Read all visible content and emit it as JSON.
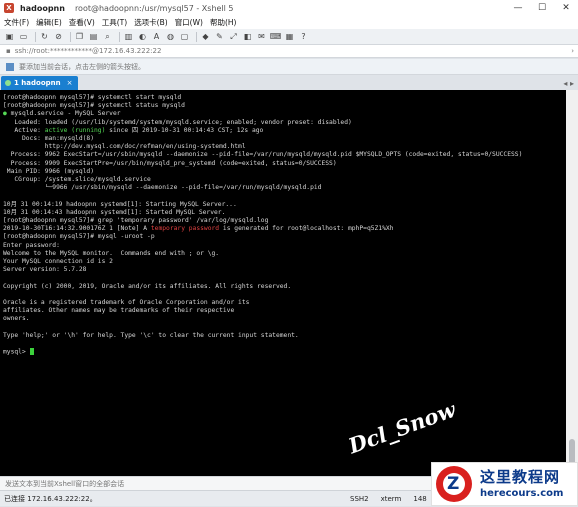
{
  "window": {
    "name": "hadoopnn",
    "subtitle": "root@hadoopnn:/usr/mysql57 - Xshell 5",
    "min_glyph": "—",
    "max_glyph": "☐",
    "close_glyph": "✕"
  },
  "menu": [
    "文件(F)",
    "编辑(E)",
    "查看(V)",
    "工具(T)",
    "选项卡(B)",
    "窗口(W)",
    "帮助(H)"
  ],
  "address": {
    "value": "ssh://root:************@172.16.43.222:22"
  },
  "hint": {
    "text": "要添加当前会话，点击左侧的箭头按钮。"
  },
  "tab": {
    "label": "1 hadoopnn"
  },
  "terminal": {
    "lines": [
      {
        "t": "[root@hadoopnn mysql57]# systemctl start mysqld"
      },
      {
        "t": "[root@hadoopnn mysql57]# systemctl status mysqld"
      },
      {
        "pre": "● ",
        "pre_color": "g",
        "t": "mysqld.service - MySQL Server"
      },
      {
        "t": "   Loaded: loaded (/usr/lib/systemd/system/mysqld.service; enabled; vendor preset: disabled)"
      },
      {
        "t": "   Active: ",
        "hl": "active (running)",
        "hl_color": "g",
        "post": " since 四 2019-10-31 00:14:43 CST; 12s ago"
      },
      {
        "t": "     Docs: man:mysqld(8)"
      },
      {
        "t": "           http://dev.mysql.com/doc/refman/en/using-systemd.html"
      },
      {
        "t": "  Process: 9962 ExecStart=/usr/sbin/mysqld --daemonize --pid-file=/var/run/mysqld/mysqld.pid $MYSQLD_OPTS (code=exited, status=0/SUCCESS)"
      },
      {
        "t": "  Process: 9909 ExecStartPre=/usr/bin/mysqld_pre_systemd (code=exited, status=0/SUCCESS)"
      },
      {
        "t": " Main PID: 9966 (mysqld)"
      },
      {
        "t": "   CGroup: /system.slice/mysqld.service"
      },
      {
        "t": "           └─9966 /usr/sbin/mysqld --daemonize --pid-file=/var/run/mysqld/mysqld.pid"
      },
      {
        "t": ""
      },
      {
        "t": "10月 31 00:14:19 hadoopnn systemd[1]: Starting MySQL Server..."
      },
      {
        "t": "10月 31 00:14:43 hadoopnn systemd[1]: Started MySQL Server."
      },
      {
        "t": "[root@hadoopnn mysql57]# grep 'temporary password' /var/log/mysqld.log"
      },
      {
        "t": "2019-10-30T16:14:32.900176Z 1 [Note] A ",
        "hl": "temporary password",
        "hl_color": "r",
        "post": " is generated for root@localhost: mphP=q5Z1%Xh"
      },
      {
        "t": "[root@hadoopnn mysql57]# mysql -uroot -p"
      },
      {
        "t": "Enter password:"
      },
      {
        "t": "Welcome to the MySQL monitor.  Commands end with ; or \\g."
      },
      {
        "t": "Your MySQL connection id is 2"
      },
      {
        "t": "Server version: 5.7.28"
      },
      {
        "t": ""
      },
      {
        "t": "Copyright (c) 2000, 2019, Oracle and/or its affiliates. All rights reserved."
      },
      {
        "t": ""
      },
      {
        "t": "Oracle is a registered trademark of Oracle Corporation and/or its"
      },
      {
        "t": "affiliates. Other names may be trademarks of their respective"
      },
      {
        "t": "owners."
      },
      {
        "t": ""
      },
      {
        "t": "Type 'help;' or '\\h' for help. Type '\\c' to clear the current input statement."
      },
      {
        "t": ""
      },
      {
        "t": "mysql> ",
        "cursor": true
      }
    ],
    "watermark": "Dcl_Snow"
  },
  "input": {
    "placeholder": "发送文本到当前Xshell窗口的全部会话"
  },
  "status": {
    "left": "已连接 172.16.43.222:22。",
    "protocol": "SSH2",
    "terminal": "xterm",
    "cols": "148"
  },
  "logo": {
    "cn": "这里教程网",
    "url": "herecours.com"
  }
}
